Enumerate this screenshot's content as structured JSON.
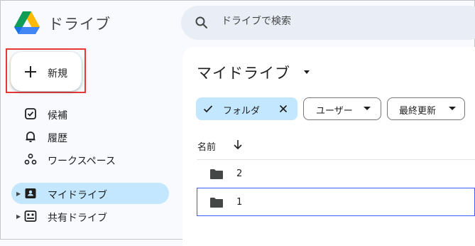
{
  "app": {
    "title": "ドライブ"
  },
  "search": {
    "placeholder": "ドライブで検索"
  },
  "new_button": {
    "label": "新規"
  },
  "sidebar": {
    "items": [
      {
        "label": "候補",
        "icon": "suggested-icon"
      },
      {
        "label": "履歴",
        "icon": "bell-icon"
      },
      {
        "label": "ワークスペース",
        "icon": "workspaces-icon"
      },
      {
        "label": "マイドライブ",
        "icon": "my-drive-icon",
        "active": true
      },
      {
        "label": "共有ドライブ",
        "icon": "shared-drives-icon"
      }
    ]
  },
  "main": {
    "title": "マイドライブ",
    "filters": [
      {
        "label": "フォルダ",
        "selected": true
      },
      {
        "label": "ユーザー"
      },
      {
        "label": "最終更新"
      }
    ],
    "column_header": "名前",
    "rows": [
      {
        "name": "2"
      },
      {
        "name": "1",
        "selected": true
      }
    ]
  },
  "colors": {
    "accent": "#c2e7ff",
    "highlight": "#e53935",
    "selection": "#3d5afe"
  }
}
